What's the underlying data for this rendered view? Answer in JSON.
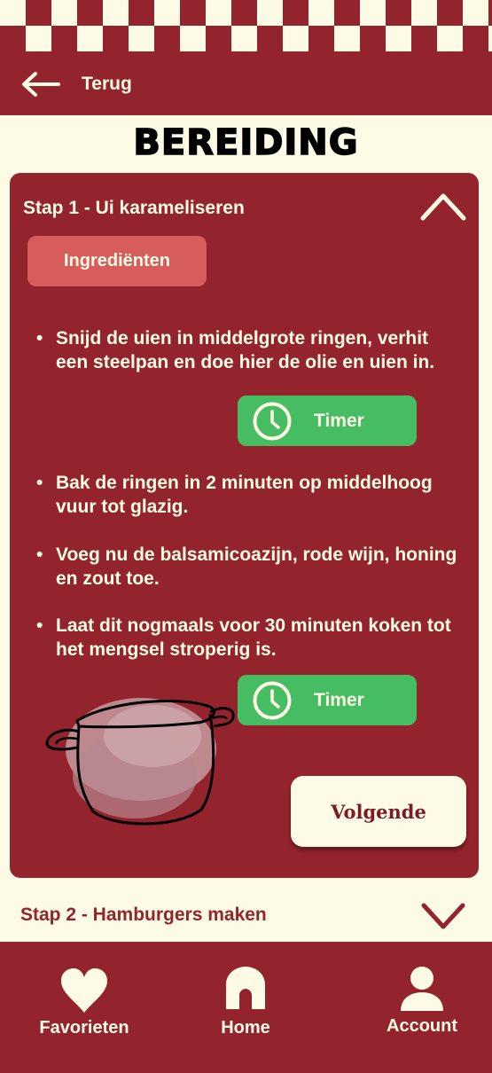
{
  "header": {
    "back_label": "Terug"
  },
  "page_title": "BEREIDING",
  "step1": {
    "title": "Stap 1 - Ui karameliseren",
    "ingredients_label": "Ingrediënten",
    "instructions": [
      "Snijd de uien in middelgrote ringen, verhit een steelpan en doe hier de olie en uien in.",
      "Bak de ringen in 2 minuten op middelhoog vuur tot glazig.",
      "Voeg nu de balsamicoazijn, rode wijn, honing en zout toe.",
      " Laat dit nogmaals voor 30 minuten koken tot het mengsel stroperig is."
    ],
    "bullet": "•",
    "timer_label": "Timer",
    "next_label": "Volgende"
  },
  "step2": {
    "title": "Stap 2 - Hamburgers maken"
  },
  "nav": {
    "favorites": "Favorieten",
    "home": "Home",
    "account": "Account"
  },
  "colors": {
    "primary": "#93242d",
    "cream": "#fdfbe6",
    "ingredient_button": "#d75c5c",
    "timer_green": "#46bd63"
  }
}
